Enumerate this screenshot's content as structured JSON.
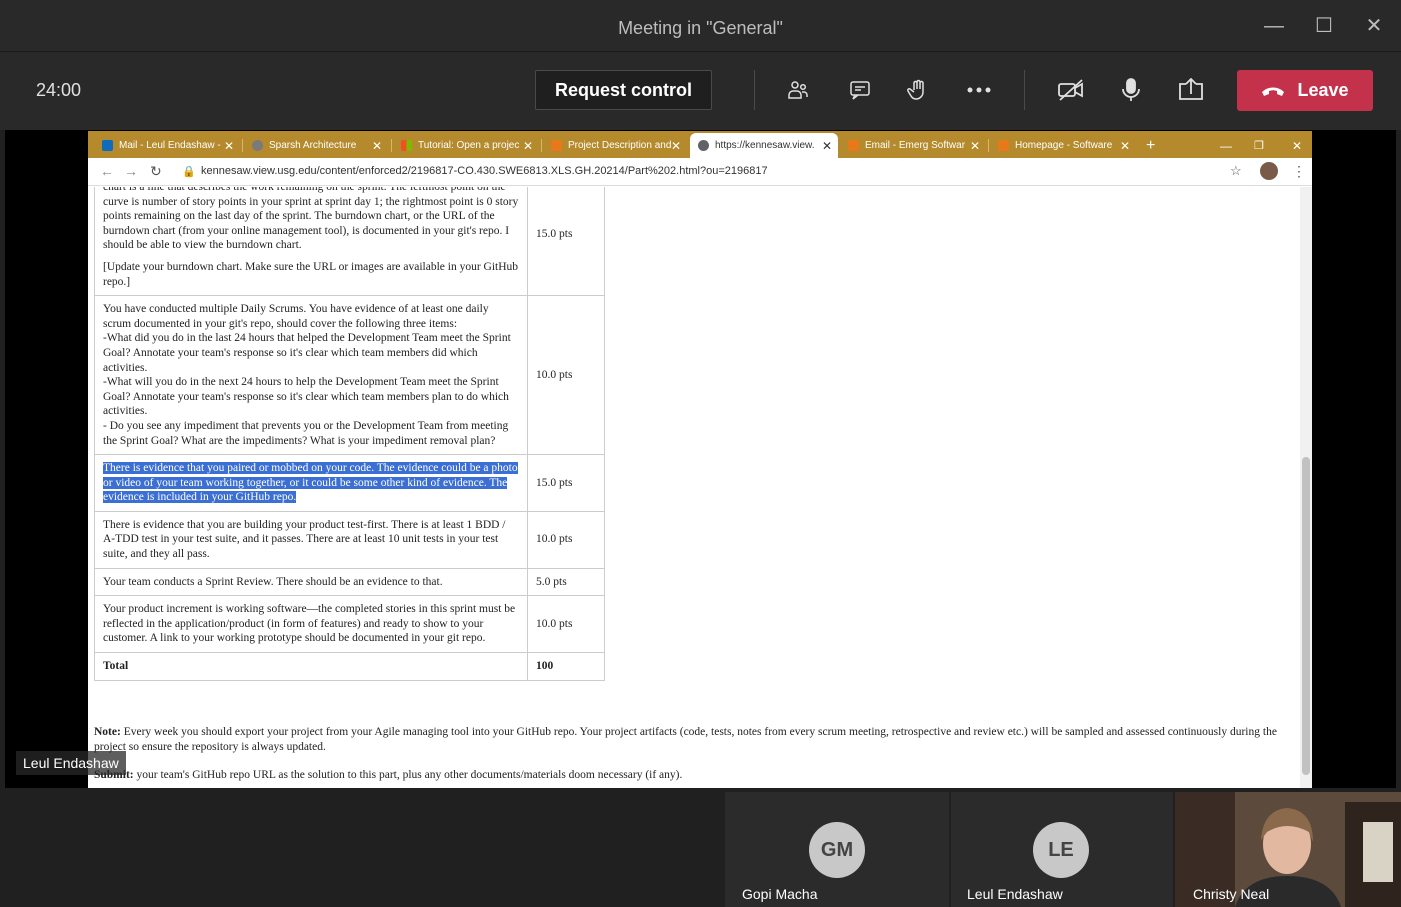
{
  "window": {
    "title": "Meeting in \"General\""
  },
  "meeting": {
    "timer": "24:00",
    "request_control": "Request control",
    "leave": "Leave"
  },
  "browser": {
    "tabs": [
      {
        "label": "Mail - Leul Endashaw -",
        "favicon_color": "#0f6cbd"
      },
      {
        "label": "Sparsh Architecture",
        "favicon_color": "#7a7a7a"
      },
      {
        "label": "Tutorial: Open a projec",
        "favicon_color": "#f25022"
      },
      {
        "label": "Project Description and",
        "favicon_color": "#e8791a"
      },
      {
        "label": "https://kennesaw.view.",
        "favicon_color": "#5f6368"
      },
      {
        "label": "Email - Emerg Softwar",
        "favicon_color": "#e8791a"
      },
      {
        "label": "Homepage - Software",
        "favicon_color": "#e8791a"
      }
    ],
    "new_tab": "+",
    "url": "kennesaw.view.usg.edu/content/enforced2/2196817-CO.430.SWE6813.XLS.GH.20214/Part%202.html?ou=2196817"
  },
  "rubric": {
    "rows": [
      {
        "criteria": "chart is a line that describes the work remaining on the sprint. The leftmost point on the curve is number of story points in your sprint at sprint day 1; the rightmost point is 0 story points remaining on the last day of the sprint. The burndown chart, or the URL of the burndown chart (from your online management tool), is documented in your git's repo. I should be able to view the burndown chart.",
        "extra": "[Update your burndown chart. Make sure the URL or images are available in your GitHub repo.]",
        "points": "15.0 pts"
      },
      {
        "criteria": "You have conducted multiple Daily Scrums. You have evidence of at least one daily scrum documented in your git's repo, should cover the following three items:",
        "lines": [
          "-What did you do in the last 24 hours that helped the Development Team meet the Sprint Goal? Annotate your team's response so it's clear which team members did which activities.",
          "-What will you do in the next 24 hours to help the Development Team meet the Sprint Goal? Annotate your team's response so it's clear which team members plan to do which activities.",
          "- Do you see any impediment that prevents you or the Development Team from meeting the Sprint Goal? What are the impediments? What is your impediment removal plan?"
        ],
        "points": "10.0 pts"
      },
      {
        "criteria": "There is evidence that you paired or mobbed on your code. The evidence could be a photo or video of your team working together, or it could be some other kind of evidence. The evidence is included in your GitHub repo.",
        "points": "15.0 pts"
      },
      {
        "criteria": "There is evidence that you are building your product test-first. There is at least 1 BDD / A-TDD test in your test suite, and it passes. There are at least 10 unit tests in your test suite, and they all pass.",
        "points": "10.0 pts"
      },
      {
        "criteria": "Your team conducts a Sprint Review. There should be an evidence to that.",
        "points": "5.0 pts"
      },
      {
        "criteria": "Your product increment is working software—the completed stories in this sprint must be reflected in the application/product (in form of features) and ready to show to your customer. A link to your working prototype should be documented in your git repo.",
        "points": "10.0 pts"
      }
    ],
    "total_label": "Total",
    "total_value": "100"
  },
  "note": {
    "label": "Note:",
    "text": " Every week you should export your project from your Agile managing tool into your GitHub repo. Your project artifacts (code, tests, notes from every scrum meeting, retrospective and review etc.) will be sampled and assessed continuously during the project so ensure the repository is always updated."
  },
  "submit": {
    "label": "Submit:",
    "text": " your team's GitHub repo URL as the solution to this part, plus any other documents/materials doom necessary (if any)."
  },
  "presenter_label": "Leul Endashaw",
  "participants": [
    {
      "initials": "GM",
      "name": "Gopi Macha"
    },
    {
      "initials": "LE",
      "name": "Leul Endashaw"
    },
    {
      "initials": "",
      "name": "Christy Neal"
    }
  ]
}
